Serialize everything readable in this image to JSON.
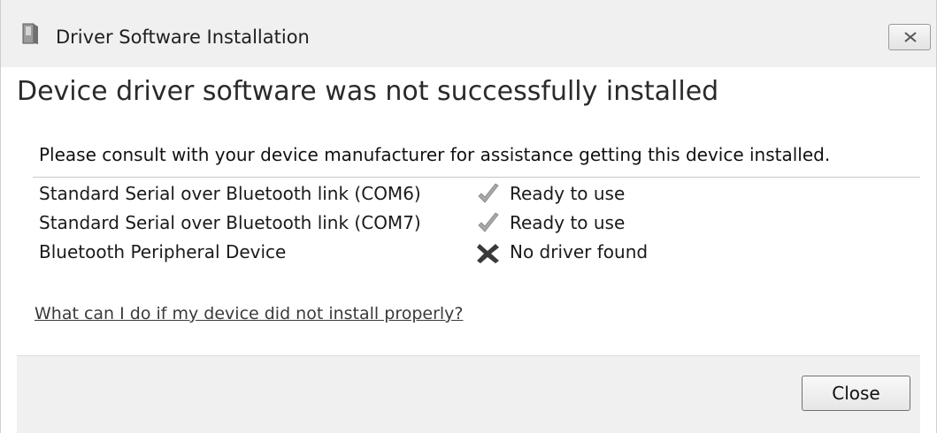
{
  "window": {
    "title": "Driver Software Installation"
  },
  "main": {
    "heading": "Device driver software was not successfully installed",
    "instruction": "Please consult with your device manufacturer for assistance getting this device installed.",
    "devices": [
      {
        "name": "Standard Serial over Bluetooth link (COM6)",
        "status": "Ready to use",
        "status_icon": "check-icon"
      },
      {
        "name": "Standard Serial over Bluetooth link (COM7)",
        "status": "Ready to use",
        "status_icon": "check-icon"
      },
      {
        "name": "Bluetooth Peripheral Device",
        "status": "No driver found",
        "status_icon": "x-icon"
      }
    ],
    "help_link": "What can I do if my device did not install properly?"
  },
  "footer": {
    "close_label": "Close"
  },
  "colors": {
    "titlebar": "#f0f0f0",
    "content": "#ffffff",
    "footer": "#f0f0f0"
  }
}
